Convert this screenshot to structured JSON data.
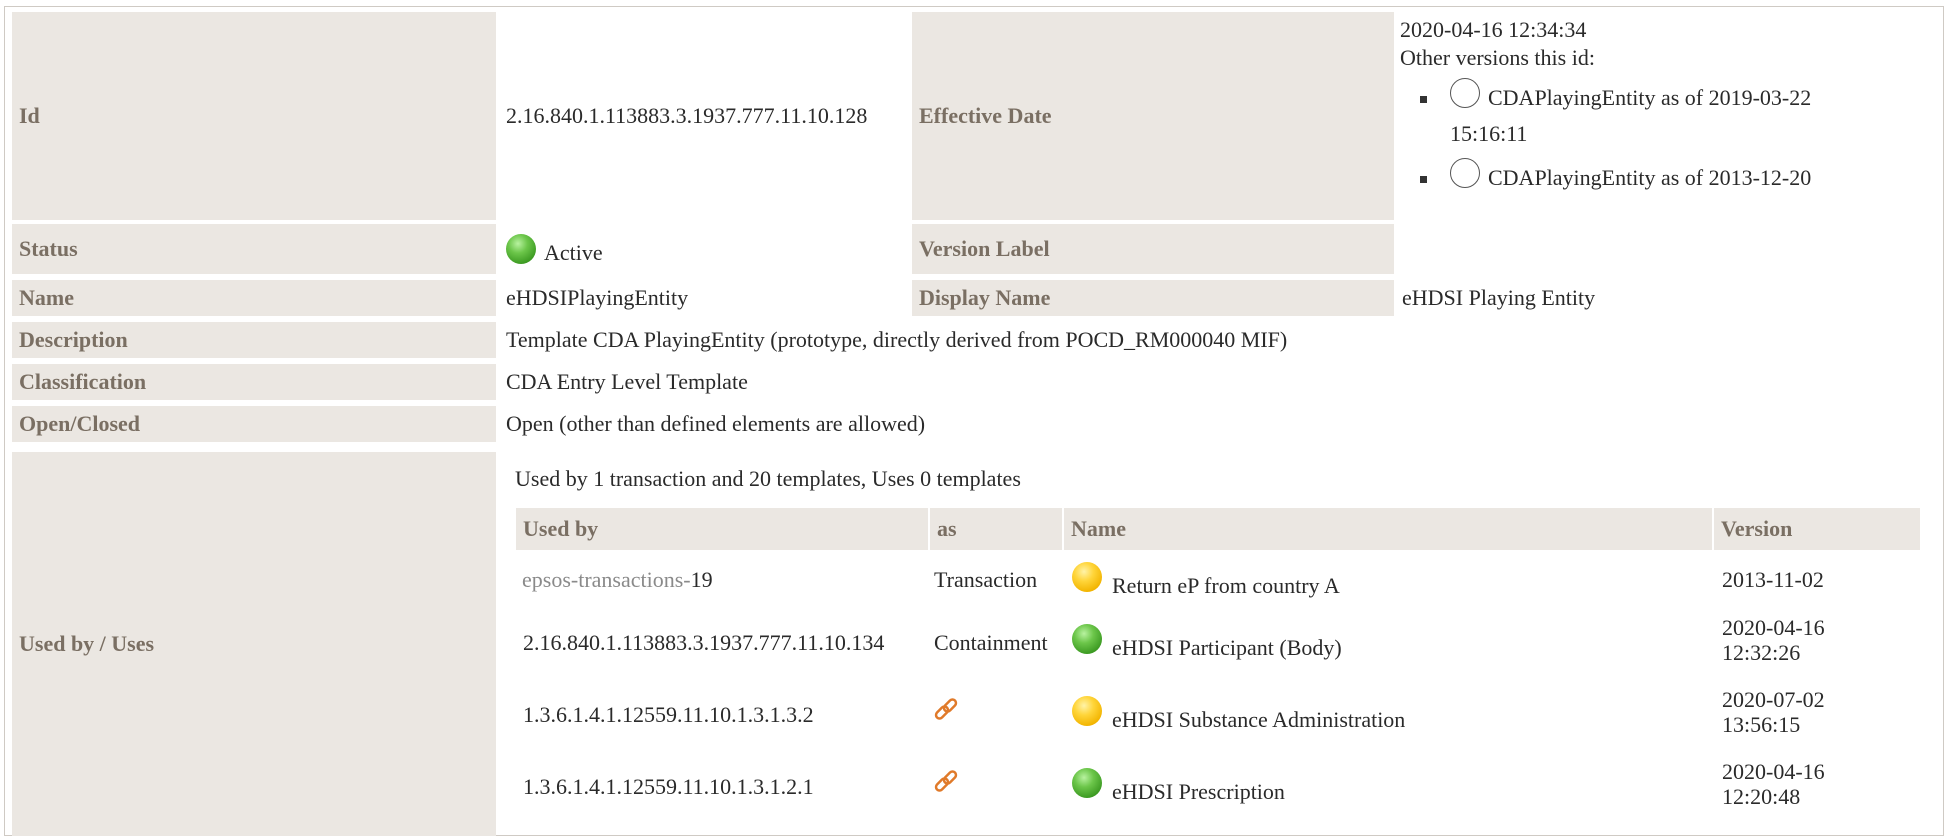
{
  "fields": {
    "id_label": "Id",
    "id_value": "2.16.840.1.113883.3.1937.777.11.10.128",
    "effective_label": "Effective Date",
    "effective_value": "2020-04-16 12:34:34",
    "other_versions_label": "Other versions this id:",
    "other_versions": [
      {
        "line1": "CDAPlayingEntity as of 2019-03-22",
        "line2": "15:16:11"
      },
      {
        "line1": "CDAPlayingEntity as of 2013-12-20",
        "line2": ""
      }
    ],
    "status_label": "Status",
    "status_value": "Active",
    "version_label_label": "Version Label",
    "version_label_value": "",
    "name_label": "Name",
    "name_value": "eHDSIPlayingEntity",
    "display_name_label": "Display Name",
    "display_name_value": "eHDSI Playing Entity",
    "description_label": "Description",
    "description_value": "Template CDA PlayingEntity (prototype, directly derived from POCD_RM000040 MIF)",
    "classification_label": "Classification",
    "classification_value": "CDA Entry Level Template",
    "open_closed_label": "Open/Closed",
    "open_closed_value": "Open (other than defined elements are allowed)",
    "used_by_label": "Used by / Uses"
  },
  "usage": {
    "summary": "Used by 1 transaction and 20 templates, Uses 0 templates",
    "headers": {
      "used_by": "Used by",
      "as": "as",
      "name": "Name",
      "version": "Version"
    },
    "rows": [
      {
        "used_by_link": "epsos-transactions-",
        "used_by": "19",
        "as": "Transaction",
        "as_icon": "",
        "status": "yellow",
        "name": "Return eP from country A",
        "version_date": "2013-11-02",
        "version_time": ""
      },
      {
        "used_by_link": "",
        "used_by": "2.16.840.1.113883.3.1937.777.11.10.134",
        "as": "Containment",
        "as_icon": "",
        "status": "green",
        "name": "eHDSI Participant (Body)",
        "version_date": "2020-04-16",
        "version_time": "12:32:26"
      },
      {
        "used_by_link": "",
        "used_by": "1.3.6.1.4.1.12559.11.10.1.3.1.3.2",
        "as": "",
        "as_icon": "link-icon",
        "status": "yellow",
        "name": "eHDSI Substance Administration",
        "version_date": "2020-07-02",
        "version_time": "13:56:15"
      },
      {
        "used_by_link": "",
        "used_by": "1.3.6.1.4.1.12559.11.10.1.3.1.2.1",
        "as": "",
        "as_icon": "link-icon",
        "status": "green",
        "name": "eHDSI Prescription",
        "version_date": "2020-04-16",
        "version_time": "12:20:48"
      }
    ]
  },
  "colors": {
    "label_bg": "#ebe7e2",
    "label_text": "#7a6f63",
    "status_green": "#4caf2e",
    "status_yellow": "#f5b800",
    "link_icon": "#e07a2a"
  }
}
